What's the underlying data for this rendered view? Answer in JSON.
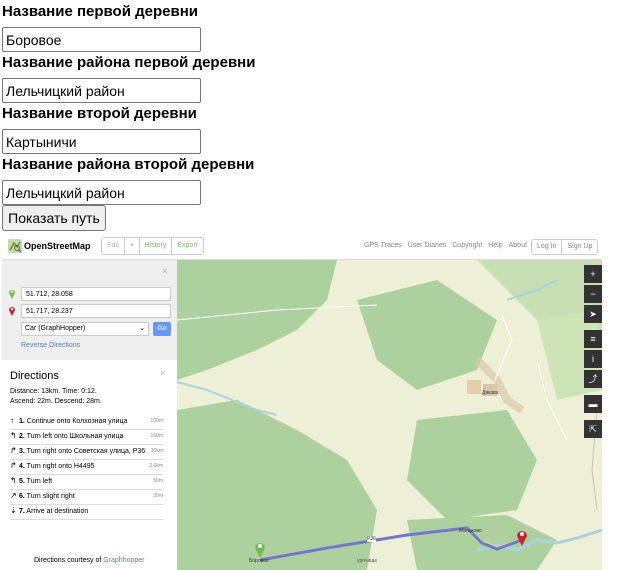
{
  "form": {
    "label1": "Название первой деревни",
    "value1": "Боровое",
    "label2": "Название района первой деревни",
    "value2": "Лельчицкий район",
    "label3": "Название второй деревни",
    "value3": "Картыничи",
    "label4": "Название района второй деревни",
    "value4": "Лельчицкий район",
    "submit": "Показать путь"
  },
  "osm": {
    "brand": "OpenStreetMap",
    "edit": "Edit",
    "dropdown": "▾",
    "history": "History",
    "export": "Export",
    "links": [
      "GPS Traces",
      "User Diaries",
      "Copyright",
      "Help",
      "About"
    ],
    "login": "Log In",
    "signup": "Sign Up",
    "from": "51.712, 28.058",
    "to": "51.717, 28.237",
    "engine": "Car (GraphHopper)",
    "go": "Go",
    "reverse": "Reverse Directions",
    "close": "×",
    "directions_title": "Directions",
    "summary1": "Distance: 13km. Time: 0:12.",
    "summary2": "Ascend: 22m. Descend: 28m.",
    "steps": [
      {
        "icon": "↑",
        "num": "1.",
        "text": "Continue onto Колхозная улица",
        "dist": "190m"
      },
      {
        "icon": "↰",
        "num": "2.",
        "text": "Turn left onto Школьная улица",
        "dist": "160m"
      },
      {
        "icon": "↱",
        "num": "3.",
        "text": "Turn right onto Советская улица, Р36",
        "dist": "10km"
      },
      {
        "icon": "↱",
        "num": "4.",
        "text": "Turn right onto Н4495",
        "dist": "2.6km"
      },
      {
        "icon": "↰",
        "num": "5.",
        "text": "Turn left",
        "dist": "50m"
      },
      {
        "icon": "↗",
        "num": "6.",
        "text": "Turn slight right",
        "dist": "30m"
      },
      {
        "icon": "⇣",
        "num": "7.",
        "text": "Arrive at destination",
        "dist": ""
      }
    ],
    "courtesy_prefix": "Directions courtesy of ",
    "courtesy_link": "Graphhopper",
    "map_labels": {
      "borovoe": "Боровое",
      "dyakovo": "Дякова",
      "mankovoe": "Маньково",
      "road": "Р36",
      "urochishche": "урочище"
    },
    "controls": [
      "+",
      "−",
      "➤",
      "≡",
      "i",
      "⤴",
      "▬",
      "⇱"
    ]
  },
  "colors": {
    "route": "#5a6ad8",
    "start_pin": "#6cc04a",
    "end_pin": "#c8222a",
    "forest": "#add19e",
    "farmland": "#eef0d5",
    "water": "#aad3df"
  }
}
